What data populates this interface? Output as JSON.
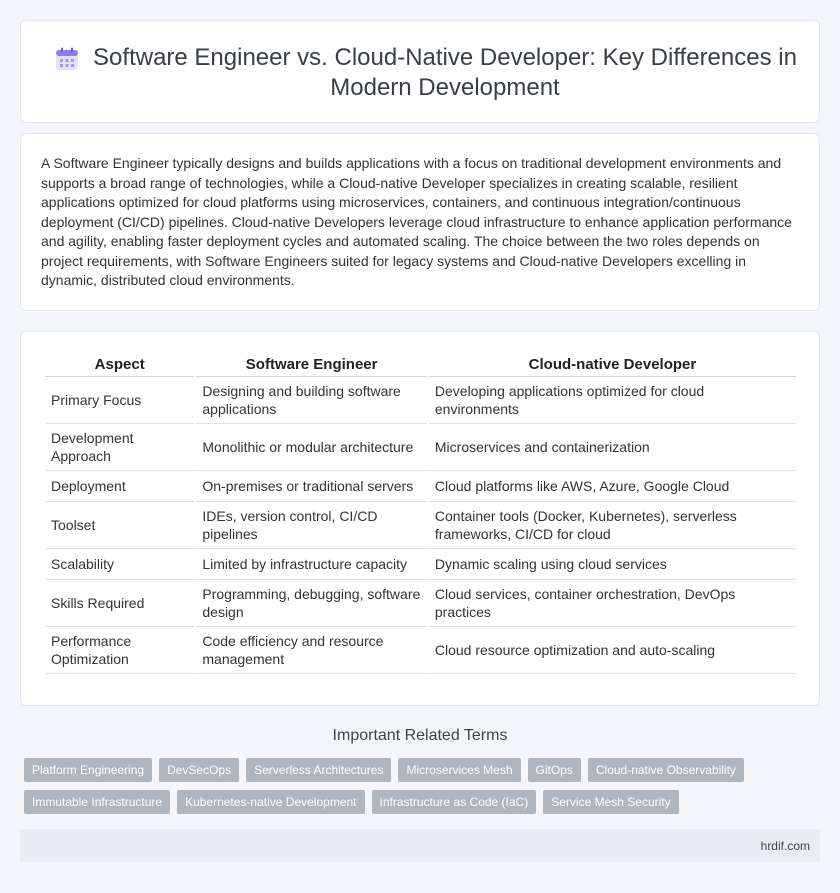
{
  "header": {
    "title": "Software Engineer vs. Cloud-Native Developer: Key Differences in Modern Development",
    "icon": "calendar-icon",
    "icon_color": "#8f7df0"
  },
  "summary": {
    "text": "A Software Engineer typically designs and builds applications with a focus on traditional development environments and supports a broad range of technologies, while a Cloud-native Developer specializes in creating scalable, resilient applications optimized for cloud platforms using microservices, containers, and continuous integration/continuous deployment (CI/CD) pipelines. Cloud-native Developers leverage cloud infrastructure to enhance application performance and agility, enabling faster deployment cycles and automated scaling. The choice between the two roles depends on project requirements, with Software Engineers suited for legacy systems and Cloud-native Developers excelling in dynamic, distributed cloud environments."
  },
  "table": {
    "headers": [
      "Aspect",
      "Software Engineer",
      "Cloud-native Developer"
    ],
    "rows": [
      [
        "Primary Focus",
        "Designing and building software applications",
        "Developing applications optimized for cloud environments"
      ],
      [
        "Development Approach",
        "Monolithic or modular architecture",
        "Microservices and containerization"
      ],
      [
        "Deployment",
        "On-premises or traditional servers",
        "Cloud platforms like AWS, Azure, Google Cloud"
      ],
      [
        "Toolset",
        "IDEs, version control, CI/CD pipelines",
        "Container tools (Docker, Kubernetes), serverless frameworks, CI/CD for cloud"
      ],
      [
        "Scalability",
        "Limited by infrastructure capacity",
        "Dynamic scaling using cloud services"
      ],
      [
        "Skills Required",
        "Programming, debugging, software design",
        "Cloud services, container orchestration, DevOps practices"
      ],
      [
        "Performance Optimization",
        "Code efficiency and resource management",
        "Cloud resource optimization and auto-scaling"
      ]
    ]
  },
  "related": {
    "title": "Important Related Terms",
    "tags": [
      "Platform Engineering",
      "DevSecOps",
      "Serverless Architectures",
      "Microservices Mesh",
      "GitOps",
      "Cloud-native Observability",
      "Immutable Infrastructure",
      "Kubernetes-native Development",
      "Infrastructure as Code (IaC)",
      "Service Mesh Security"
    ]
  },
  "footer": {
    "site": "hrdif.com"
  }
}
